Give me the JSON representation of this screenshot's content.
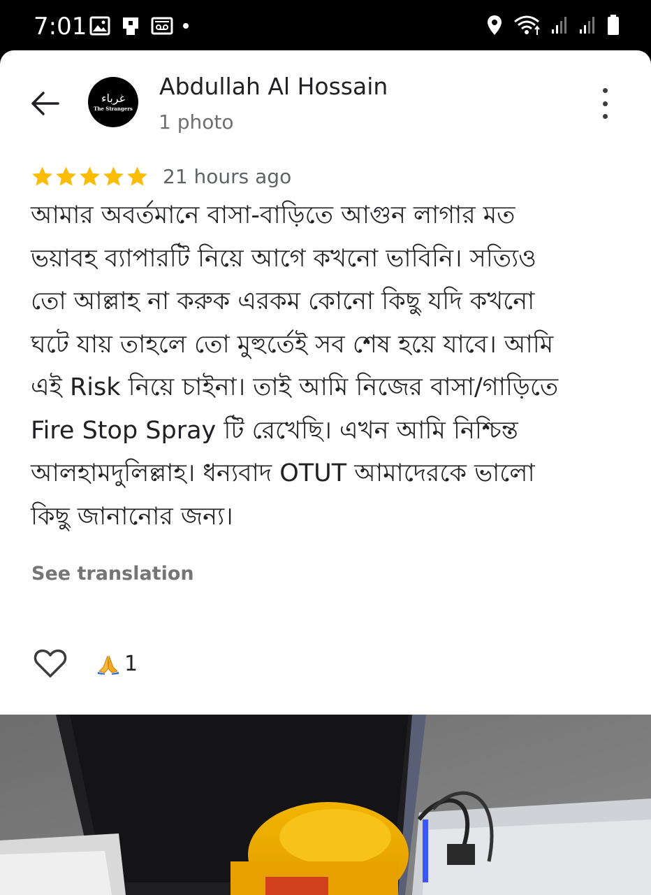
{
  "status_bar": {
    "time": "7:01",
    "left_icons": [
      "gallery-icon",
      "sim-card-icon",
      "voicemail-icon",
      "notification-dot-icon"
    ],
    "right_icons": [
      "location-icon",
      "wifi-icon",
      "signal-icon",
      "signal-icon",
      "battery-icon"
    ]
  },
  "header": {
    "reviewer_name": "Abdullah Al Hossain",
    "photo_count": "1 photo",
    "avatar_logo_text": "غرباء",
    "avatar_logo_caption": "The Strangers"
  },
  "review": {
    "rating": 5,
    "max_rating": 5,
    "time_ago": "21 hours ago",
    "text": "আমার অবর্তমানে বাসা-বাড়িতে আগুন লাগার মত\nভয়াবহ ব্যাপারটি নিয়ে আগে কখনো ভাবিনি। সত্যিও\nতো আল্লাহ না করুক এরকম কোনো কিছু যদি কখনো\nঘটে যায় তাহলে তো মুহুর্তেই সব শেষ হয়ে যাবে। আমি\nএই Risk নিয়ে চাইনা। তাই আমি নিজের বাসা/গাড়িতে\nFire Stop Spray টি রেখেছি। এখন আমি নিশ্চিন্ত\nআলহামদুলিল্লাহ। ধন্যবাদ OTUT আমাদেরকে ভালো\nকিছু জানানোর জন্য।",
    "see_translation": "See translation",
    "reaction_emoji": "🙏",
    "reaction_count": "1"
  },
  "colors": {
    "star": "#fbbc04",
    "text_primary": "#202124",
    "text_secondary": "#6f6f6f",
    "status_bar_bg": "#000000"
  }
}
